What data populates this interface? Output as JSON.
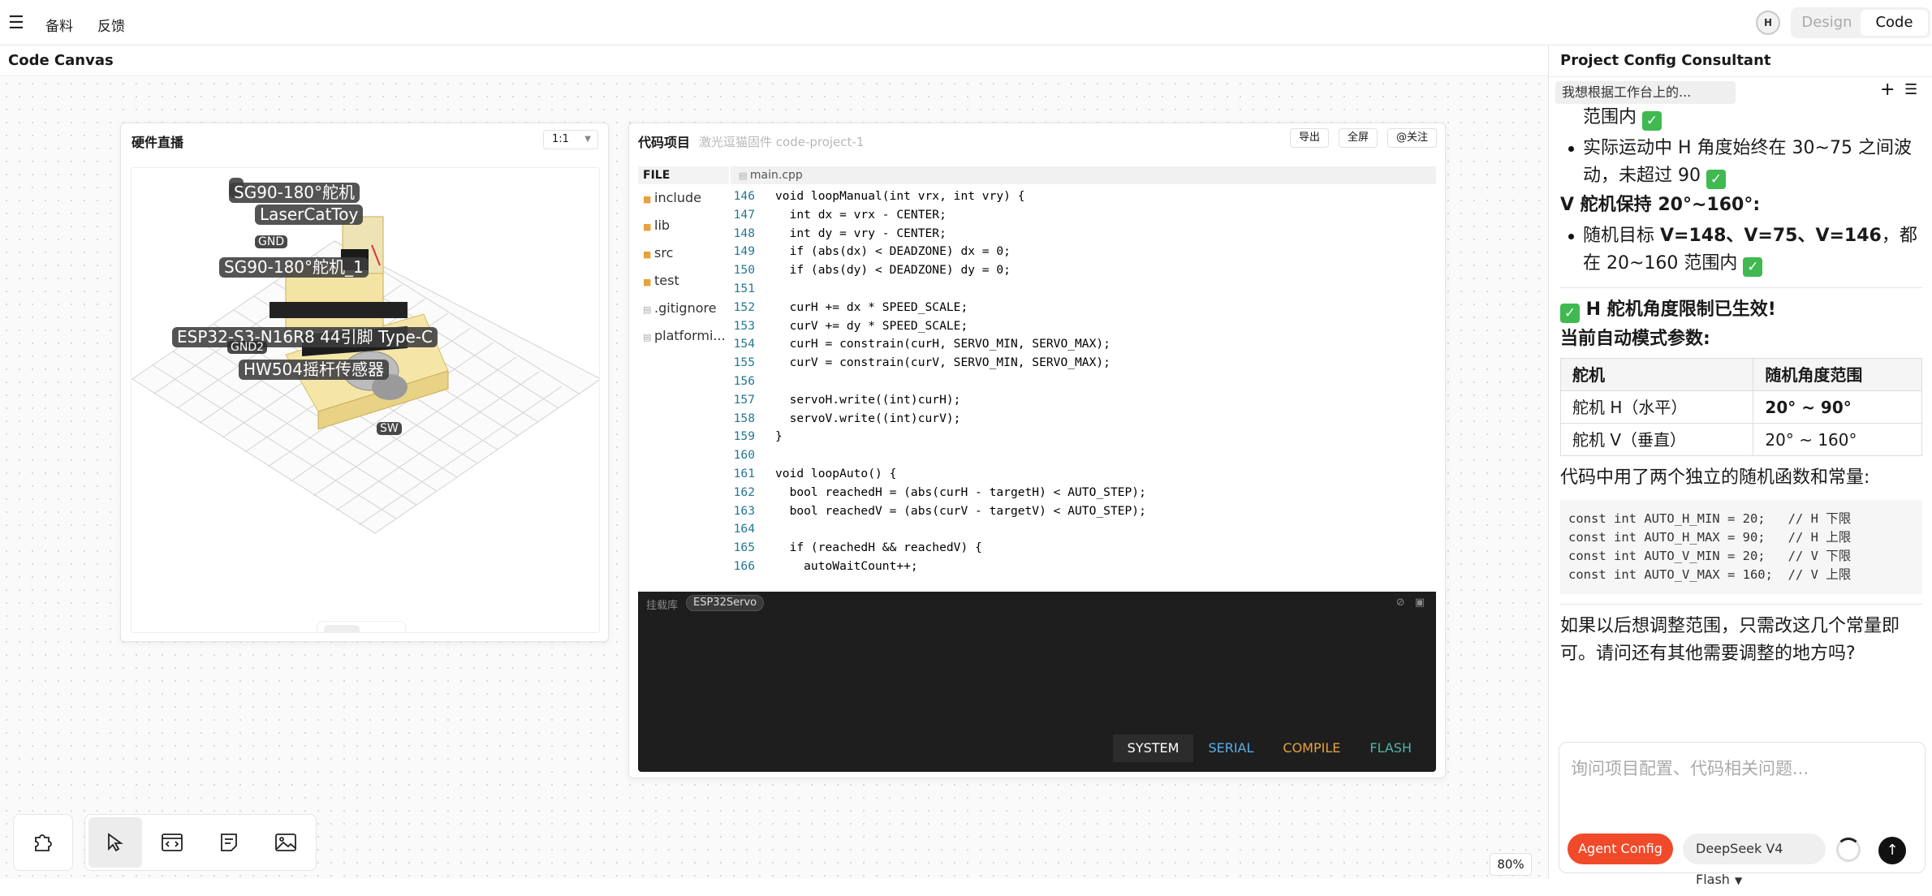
{
  "topbar": {
    "nav": [
      "备料",
      "反馈"
    ],
    "avatar": "H",
    "mode_design": "Design",
    "mode_code": "Code"
  },
  "canvas": {
    "title": "Code Canvas",
    "zoom": "80%"
  },
  "hardware": {
    "title": "硬件直播",
    "ratio": "1:1",
    "labels": [
      "SG90-180°舵机",
      "LaserCatToy",
      "SG90-180°舵机_1",
      "ESP32-S3-N16R8 44引脚 Type-C",
      "HW504摇杆传感器"
    ],
    "small_labels": [
      "GND",
      "GND2",
      "SW"
    ]
  },
  "code": {
    "title": "代码项目",
    "subtitle": "激光逗猫固件 code-project-1",
    "buttons": [
      "导出",
      "全屏",
      "@关注"
    ],
    "file_header": "FILE",
    "files": [
      {
        "name": "include",
        "type": "folder"
      },
      {
        "name": "lib",
        "type": "folder"
      },
      {
        "name": "src",
        "type": "folder"
      },
      {
        "name": "test",
        "type": "folder"
      },
      {
        "name": ".gitignore",
        "type": "file"
      },
      {
        "name": "platformi...",
        "type": "file"
      }
    ],
    "tab": "main.cpp",
    "lines": [
      {
        "n": "146",
        "t": "void loopManual(int vrx, int vry) {"
      },
      {
        "n": "147",
        "t": "  int dx = vrx - CENTER;"
      },
      {
        "n": "148",
        "t": "  int dy = vry - CENTER;"
      },
      {
        "n": "149",
        "t": "  if (abs(dx) < DEADZONE) dx = 0;"
      },
      {
        "n": "150",
        "t": "  if (abs(dy) < DEADZONE) dy = 0;"
      },
      {
        "n": "151",
        "t": ""
      },
      {
        "n": "152",
        "t": "  curH += dx * SPEED_SCALE;"
      },
      {
        "n": "153",
        "t": "  curV += dy * SPEED_SCALE;"
      },
      {
        "n": "154",
        "t": "  curH = constrain(curH, SERVO_MIN, SERVO_MAX);"
      },
      {
        "n": "155",
        "t": "  curV = constrain(curV, SERVO_MIN, SERVO_MAX);"
      },
      {
        "n": "156",
        "t": ""
      },
      {
        "n": "157",
        "t": "  servoH.write((int)curH);"
      },
      {
        "n": "158",
        "t": "  servoV.write((int)curV);"
      },
      {
        "n": "159",
        "t": "}"
      },
      {
        "n": "160",
        "t": ""
      },
      {
        "n": "161",
        "t": "void loopAuto() {"
      },
      {
        "n": "162",
        "t": "  bool reachedH = (abs(curH - targetH) < AUTO_STEP);"
      },
      {
        "n": "163",
        "t": "  bool reachedV = (abs(curV - targetV) < AUTO_STEP);"
      },
      {
        "n": "164",
        "t": ""
      },
      {
        "n": "165",
        "t": "  if (reachedH && reachedV) {"
      },
      {
        "n": "166",
        "t": "    autoWaitCount++;"
      }
    ],
    "terminal": {
      "lib_label": "挂载库",
      "lib": "ESP32Servo",
      "tabs": [
        "SYSTEM",
        "SERIAL",
        "COMPILE",
        "FLASH"
      ]
    }
  },
  "consultant": {
    "title": "Project Config Consultant",
    "thread": "我想根据工作台上的...",
    "msg": {
      "line0": "范围内",
      "bullet1": "实际运动中 H 角度始终在 30~75 之间波动，未超过 90",
      "vhead": "V 舵机保持 20°~160°:",
      "bullet2_pre": "随机目标 ",
      "bullet2_bold": "V=148、V=75、V=146",
      "bullet2_post": "，都在 20~160 范围内",
      "h_ok": "H 舵机角度限制已生效!",
      "params": "当前自动模式参数:",
      "table": {
        "headers": [
          "舵机",
          "随机角度范围"
        ],
        "rows": [
          [
            "舵机 H（水平）",
            "20° ~ 90°"
          ],
          [
            "舵机 V（垂直）",
            "20° ~ 160°"
          ]
        ]
      },
      "code_intro": "代码中用了两个独立的随机函数和常量:",
      "code": "const int AUTO_H_MIN = 20;   // H 下限\nconst int AUTO_H_MAX = 90;   // H 上限\nconst int AUTO_V_MIN = 20;   // V 下限\nconst int AUTO_V_MAX = 160;  // V 上限",
      "closing": "如果以后想调整范围，只需改这几个常量即可。请问还有其他需要调整的地方吗?"
    },
    "input_placeholder": "询问项目配置、代码相关问题...",
    "agent_btn": "Agent Config",
    "model": "DeepSeek V4 Flash"
  }
}
